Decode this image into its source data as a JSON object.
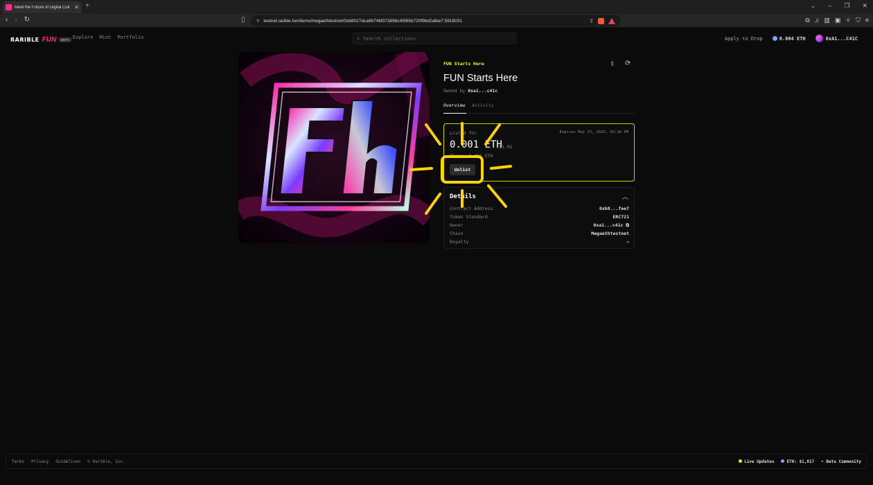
{
  "browser": {
    "tab_title": "Meet the Future of Digital Coll",
    "url": "testnet.rarible.fun/items/megaethtestnet/0xb8027dca96746f073896c45f65b720f9bd2afee7:5916031"
  },
  "site": {
    "logo_text": "RARIBLE",
    "logo_fun": "FUN",
    "logo_badge": "BETA",
    "nav": [
      "Explore",
      "Mint",
      "Portfolio"
    ],
    "search_placeholder": "Search collections",
    "apply_label": "Apply to Drop",
    "balance": "0.004 ETH",
    "account": "0xA1...C41C"
  },
  "item": {
    "collection": "FUN Starts Here",
    "title": "FUN Starts Here",
    "owned_prefix": "Owned by",
    "owner": "0xa1...c41c",
    "tabs": [
      "Overview",
      "Activity"
    ]
  },
  "listing": {
    "label": "Listed for",
    "expires": "Expires May 25, 2025, 02:16 PM",
    "price": "0.001 ETH",
    "usd": "$1.91",
    "floor": "Floor: 0.001 ETH",
    "unlist_label": "Unlist"
  },
  "details": {
    "heading": "Details",
    "rows": [
      {
        "key": "Contract Address",
        "value": "0xb8...fee7"
      },
      {
        "key": "Token Standard",
        "value": "ERC721"
      },
      {
        "key": "Owner",
        "value": "0xa1...c41c"
      },
      {
        "key": "Chain",
        "value": "Megaethtestnet"
      },
      {
        "key": "Royalty",
        "value": "–"
      }
    ]
  },
  "footer": {
    "links": [
      "Terms",
      "Privacy",
      "Guidelines",
      "© Rarible, Inc."
    ],
    "live": "Live Updates",
    "eth_price": "ETH: $1,817",
    "community": "Beta Community"
  },
  "colors": {
    "accent": "#d6ff33",
    "brand": "#ff2d8a",
    "annotation": "#ffd400"
  }
}
